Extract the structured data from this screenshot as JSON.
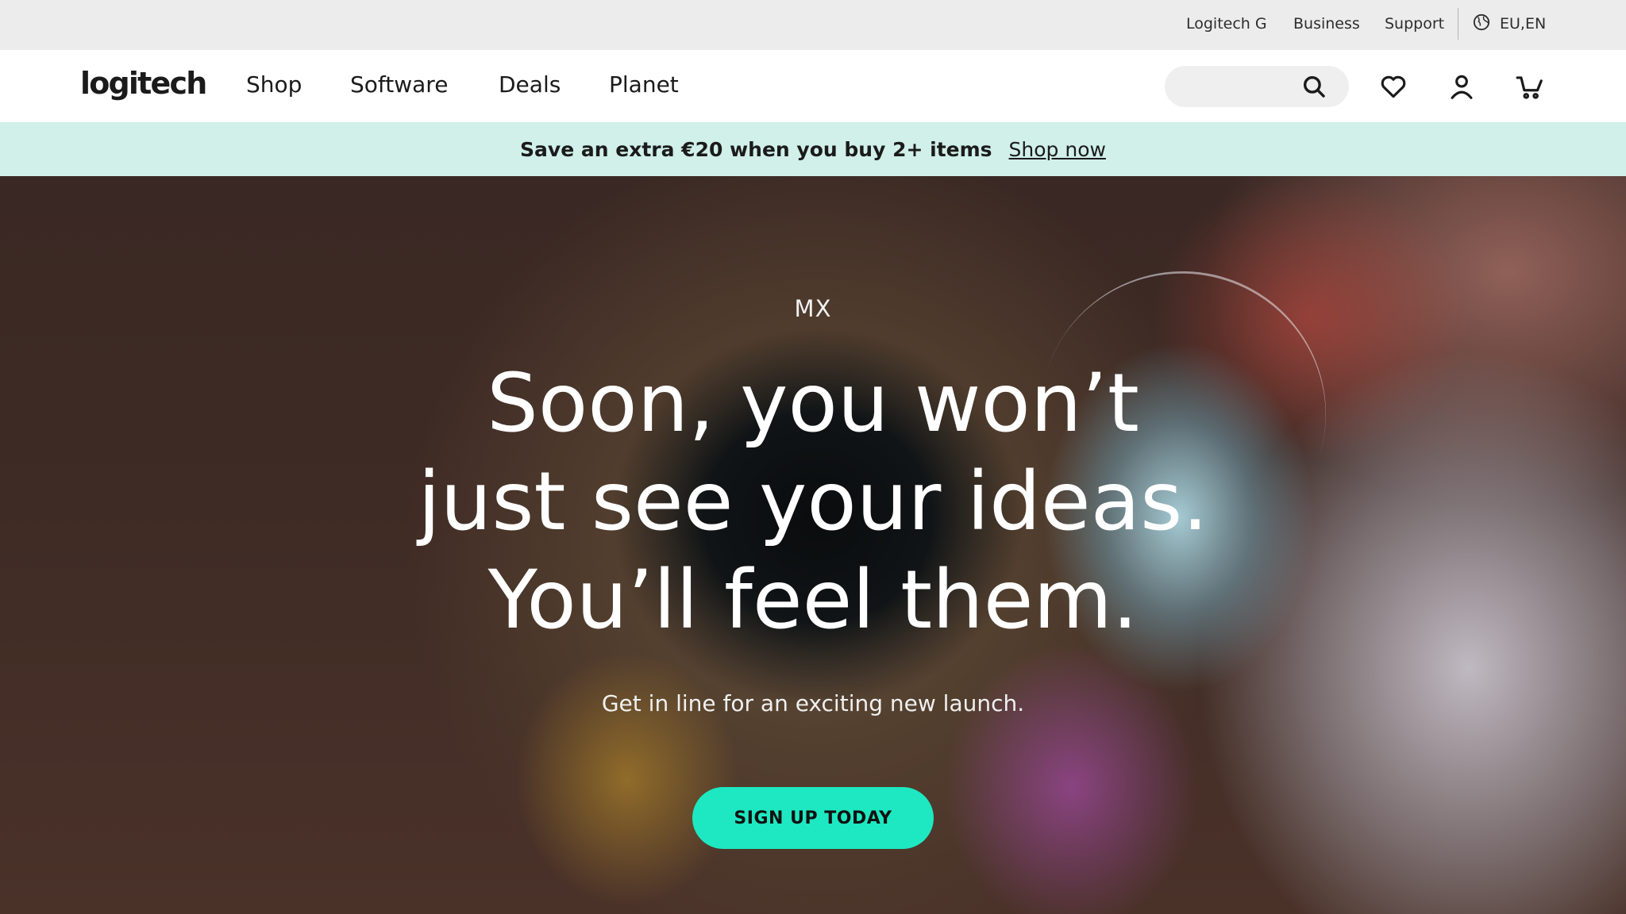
{
  "utility_bar": {
    "links": [
      "Logitech G",
      "Business",
      "Support"
    ],
    "locale": "EU,EN"
  },
  "nav": {
    "logo": "logitech",
    "links": [
      "Shop",
      "Software",
      "Deals",
      "Planet"
    ],
    "search": {
      "value": "",
      "placeholder": ""
    },
    "icons": [
      "search-icon",
      "heart-icon",
      "user-icon",
      "cart-icon"
    ]
  },
  "promo": {
    "text": "Save an extra €20 when you buy 2+ items",
    "link": "Shop now"
  },
  "hero": {
    "eyebrow": "MX",
    "title_lines": [
      "Soon, you won’t",
      "just see your ideas.",
      "You’ll feel them."
    ],
    "subtitle": "Get in line for an exciting new launch.",
    "cta": "SIGN UP TODAY"
  },
  "colors": {
    "utility_bg": "#ececec",
    "promo_bg": "#d0f0e9",
    "cta_bg": "#1ee8c1"
  }
}
